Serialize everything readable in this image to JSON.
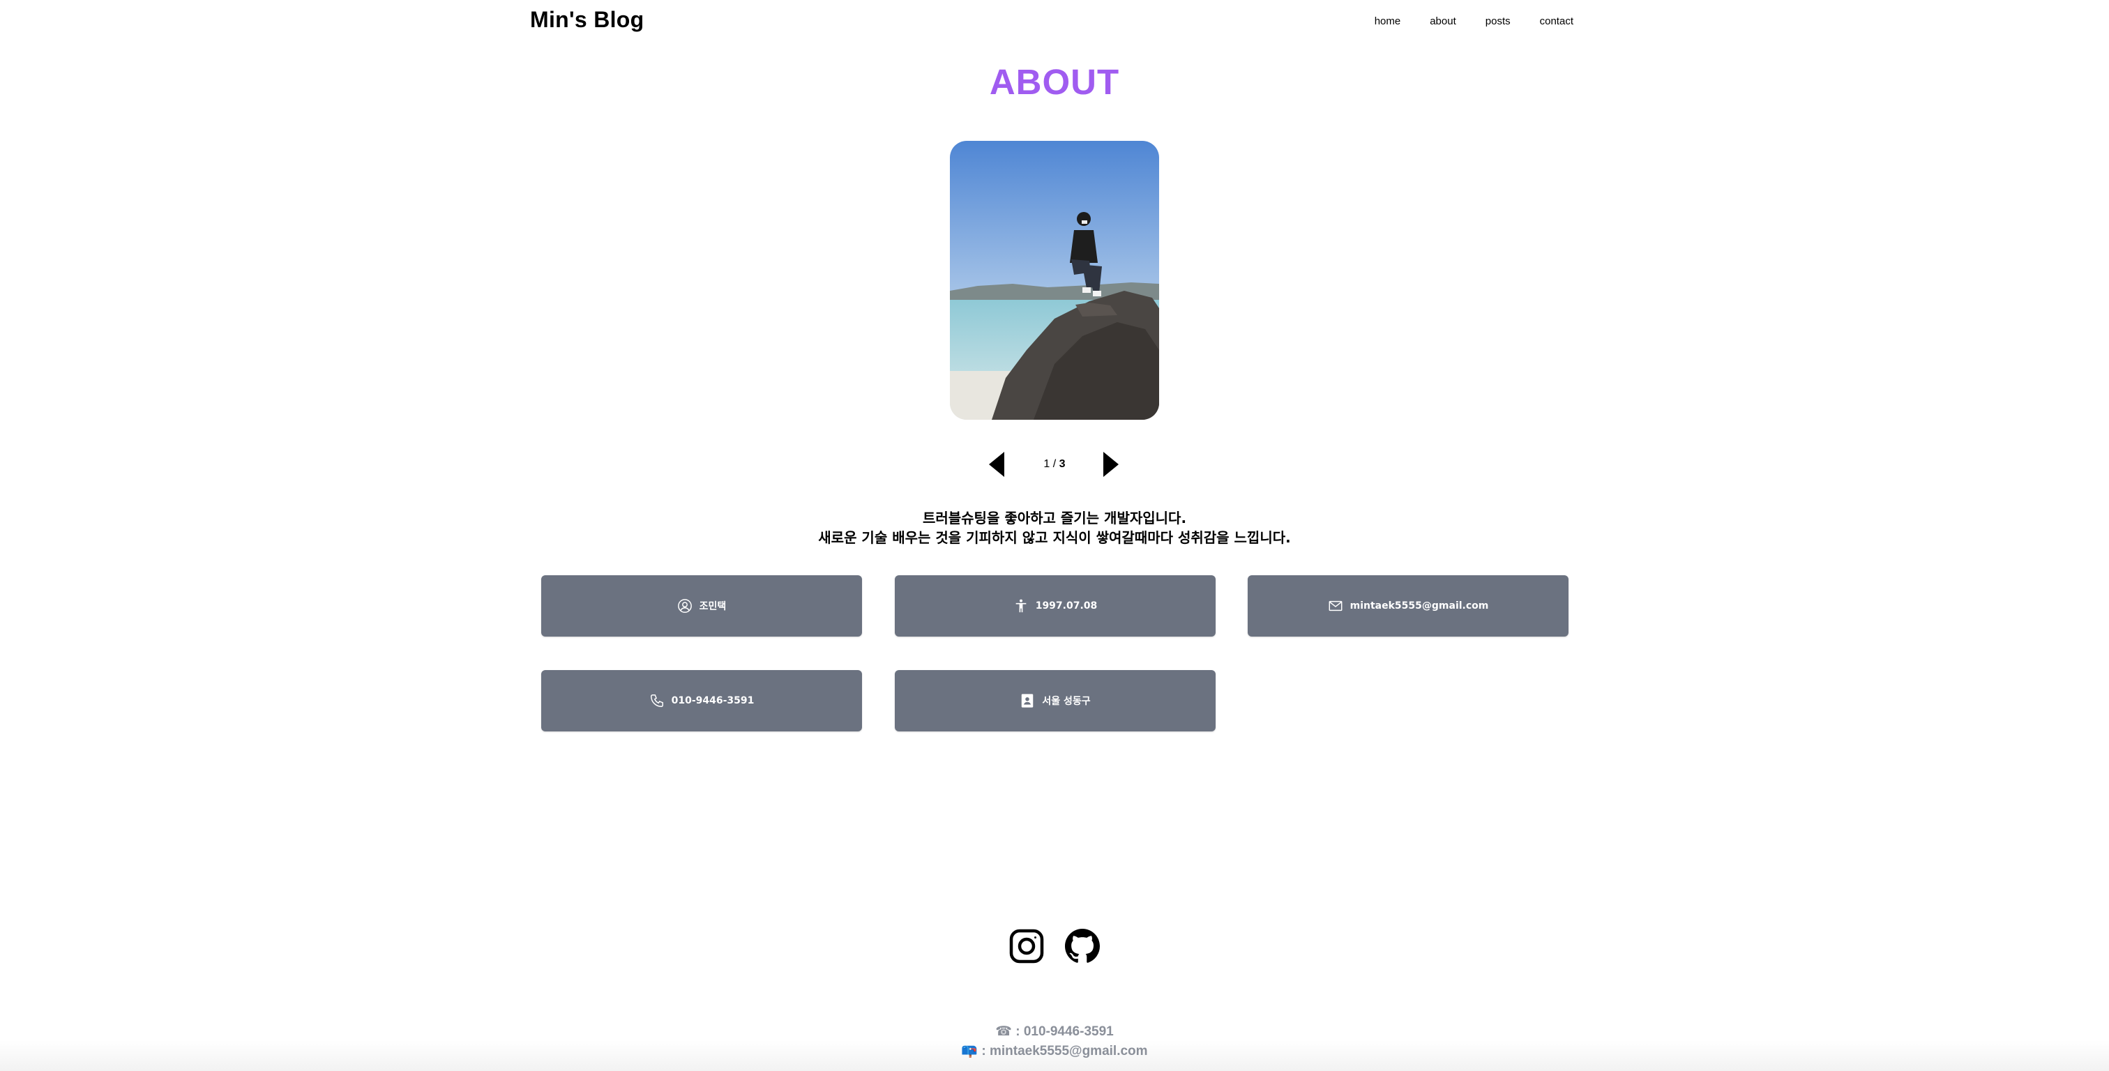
{
  "header": {
    "logo": "Min's Blog",
    "nav": [
      "home",
      "about",
      "posts",
      "contact"
    ]
  },
  "page": {
    "title": "ABOUT"
  },
  "carousel": {
    "current": "1",
    "separator": " / ",
    "total": "3"
  },
  "intro": {
    "line1": "트러블슈팅을 좋아하고 즐기는 개발자입니다.",
    "line2": "새로운 기술 배우는 것을 기피하지 않고 지식이 쌓여갈때마다 성취감을 느낍니다."
  },
  "info_cards": [
    {
      "icon": "user-circle-icon",
      "text": "조민택"
    },
    {
      "icon": "person-figure-icon",
      "text": "1997.07.08"
    },
    {
      "icon": "mail-icon",
      "text": "mintaek5555@gmail.com"
    },
    {
      "icon": "phone-icon",
      "text": "010-9446-3591"
    },
    {
      "icon": "contact-book-icon",
      "text": "서울 성동구"
    }
  ],
  "social": [
    "instagram-icon",
    "github-icon"
  ],
  "footer": {
    "phone_glyph": "☎",
    "phone": " : 010-9446-3591",
    "mail_glyph": "📪",
    "email": " : mintaek5555@gmail.com"
  },
  "colors": {
    "title": "#a05cf0",
    "card_bg": "#6b7280",
    "footer_text": "#8a8f99"
  }
}
